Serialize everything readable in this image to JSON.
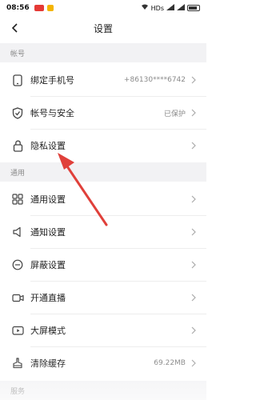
{
  "status_bar": {
    "time": "08:56",
    "network": "HDs"
  },
  "nav": {
    "title": "设置"
  },
  "sections": {
    "account": "帐号",
    "general": "通用",
    "service": "服务"
  },
  "rows": {
    "phone": {
      "label": "绑定手机号",
      "value": "+86130****6742"
    },
    "security": {
      "label": "帐号与安全",
      "value": "已保护"
    },
    "privacy": {
      "label": "隐私设置"
    },
    "general_settings": {
      "label": "通用设置"
    },
    "notification": {
      "label": "通知设置"
    },
    "block": {
      "label": "屏蔽设置"
    },
    "live": {
      "label": "开通直播"
    },
    "bigscreen": {
      "label": "大屏模式"
    },
    "cache": {
      "label": "清除缓存",
      "value": "69.22MB"
    }
  },
  "colors": {
    "annotation_arrow": "#e0403a"
  }
}
